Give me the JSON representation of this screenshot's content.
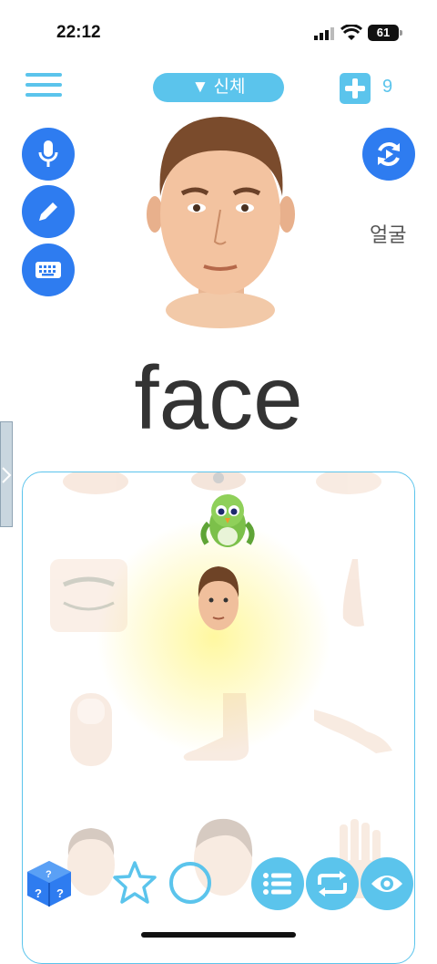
{
  "status": {
    "time": "22:12",
    "battery": "61"
  },
  "header": {
    "category": "▼ 신체",
    "count": "9"
  },
  "card": {
    "english": "face",
    "korean": "얼굴"
  },
  "colors": {
    "accent": "#5bc4ec",
    "button_blue": "#2e7cf0"
  },
  "icons": [
    "menu-icon",
    "plus-icon",
    "microphone-icon",
    "pencil-icon",
    "keyboard-icon",
    "refresh-icon",
    "dice-icon",
    "star-icon",
    "circle-icon",
    "list-icon",
    "repeat-icon",
    "eye-icon"
  ]
}
